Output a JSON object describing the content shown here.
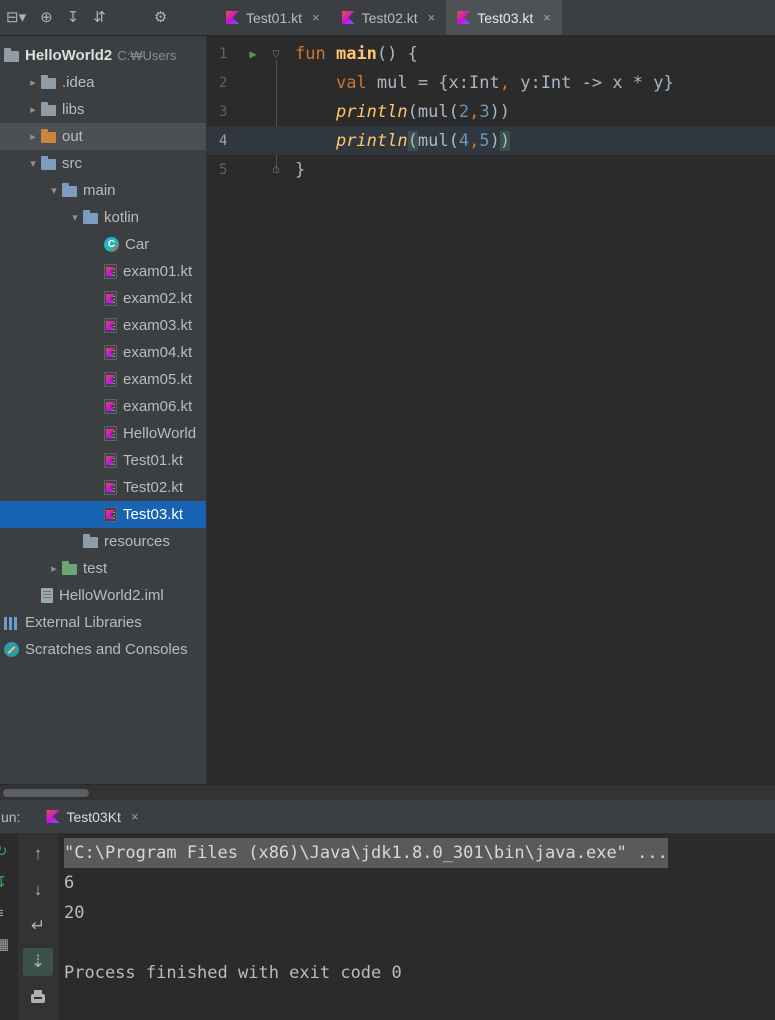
{
  "colors": {
    "selection_blue": "#1963B4",
    "hover_grey": "#4C5052",
    "keyword_orange": "#CC7832",
    "function_yellow": "#FFC66B",
    "number_blue": "#6897BB",
    "run_green": "#499C54",
    "panel_bg": "#3C3F41",
    "editor_bg": "#2B2B2B",
    "console_highlight": "#5A5A5A"
  },
  "ui": {
    "close_glyph": "×",
    "chevron_down": "▾",
    "chevron_right": "▸",
    "run_arrow": "▶",
    "fold_marker": "⌂"
  },
  "toolbar": {
    "icons": [
      {
        "name": "main-menu-icon",
        "glyph": "⊟▾"
      },
      {
        "name": "navigate-icon",
        "glyph": "⊕"
      },
      {
        "name": "update-project-icon",
        "glyph": "↧"
      },
      {
        "name": "sync-icon",
        "glyph": "⇵"
      },
      {
        "name": "settings-icon",
        "glyph": "⚙",
        "gap": true
      }
    ]
  },
  "tabs": [
    {
      "label": "Test01.kt",
      "active": false
    },
    {
      "label": "Test02.kt",
      "active": false
    },
    {
      "label": "Test03.kt",
      "active": true
    }
  ],
  "project": {
    "items": [
      {
        "label": "HelloWorld2",
        "sub": "C:₩Users",
        "level": 0,
        "chev": "none",
        "icon": "folder",
        "bold": true
      },
      {
        "label": ".idea",
        "level": 1,
        "chev": "right",
        "icon": "folder"
      },
      {
        "label": "libs",
        "level": 1,
        "chev": "right",
        "icon": "folder"
      },
      {
        "label": "out",
        "level": 1,
        "chev": "right",
        "icon": "folder-out",
        "hovered": true
      },
      {
        "label": "src",
        "level": 1,
        "chev": "down",
        "icon": "folder-src"
      },
      {
        "label": "main",
        "level": 2,
        "chev": "down",
        "icon": "folder-src"
      },
      {
        "label": "kotlin",
        "level": 3,
        "chev": "down",
        "icon": "folder-src"
      },
      {
        "label": "Car",
        "level": 4,
        "chev": "none",
        "icon": "ktclass"
      },
      {
        "label": "exam01.kt",
        "level": 4,
        "chev": "none",
        "icon": "ktfile"
      },
      {
        "label": "exam02.kt",
        "level": 4,
        "chev": "none",
        "icon": "ktfile"
      },
      {
        "label": "exam03.kt",
        "level": 4,
        "chev": "none",
        "icon": "ktfile"
      },
      {
        "label": "exam04.kt",
        "level": 4,
        "chev": "none",
        "icon": "ktfile"
      },
      {
        "label": "exam05.kt",
        "level": 4,
        "chev": "none",
        "icon": "ktfile"
      },
      {
        "label": "exam06.kt",
        "level": 4,
        "chev": "none",
        "icon": "ktfile"
      },
      {
        "label": "HelloWorld",
        "level": 4,
        "chev": "none",
        "icon": "ktfile"
      },
      {
        "label": "Test01.kt",
        "level": 4,
        "chev": "none",
        "icon": "ktfile"
      },
      {
        "label": "Test02.kt",
        "level": 4,
        "chev": "none",
        "icon": "ktfile"
      },
      {
        "label": "Test03.kt",
        "level": 4,
        "chev": "none",
        "icon": "ktfile",
        "selected": true
      },
      {
        "label": "resources",
        "level": 3,
        "chev": "none",
        "icon": "folder"
      },
      {
        "label": "test",
        "level": 2,
        "chev": "right",
        "icon": "folder-test"
      },
      {
        "label": "HelloWorld2.iml",
        "level": 1,
        "chev": "none",
        "icon": "file"
      },
      {
        "label": "External Libraries",
        "level": 0,
        "chev": "none",
        "icon": "lib"
      },
      {
        "label": "Scratches and Consoles",
        "level": 0,
        "chev": "none",
        "icon": "scratch"
      }
    ]
  },
  "editor": {
    "lines": [
      {
        "num": "1",
        "run": true,
        "fold": "start",
        "current": false,
        "segments": [
          {
            "t": "fun",
            "c": "kw"
          },
          {
            "t": " ",
            "c": "pl"
          },
          {
            "t": "main",
            "c": "fn"
          },
          {
            "t": "() {",
            "c": "pl"
          }
        ]
      },
      {
        "num": "2",
        "run": false,
        "fold": "",
        "current": false,
        "segments": [
          {
            "t": "    ",
            "c": "pl"
          },
          {
            "t": "val",
            "c": "kw"
          },
          {
            "t": " mul = {x:Int",
            "c": "pl"
          },
          {
            "t": ",",
            "c": "cm"
          },
          {
            "t": " y:Int -> x * y}",
            "c": "pl"
          }
        ]
      },
      {
        "num": "3",
        "run": false,
        "fold": "",
        "current": false,
        "segments": [
          {
            "t": "    ",
            "c": "pl"
          },
          {
            "t": "println",
            "c": "call"
          },
          {
            "t": "(",
            "c": "pl"
          },
          {
            "t": "mul(",
            "c": "pl"
          },
          {
            "t": "2",
            "c": "num"
          },
          {
            "t": ",",
            "c": "cm"
          },
          {
            "t": "3",
            "c": "num"
          },
          {
            "t": "))",
            "c": "pl"
          }
        ]
      },
      {
        "num": "4",
        "run": false,
        "fold": "",
        "current": true,
        "segments": [
          {
            "t": "    ",
            "c": "pl"
          },
          {
            "t": "println",
            "c": "call"
          },
          {
            "t": "(",
            "c": "pl hl"
          },
          {
            "t": "mul(",
            "c": "pl"
          },
          {
            "t": "4",
            "c": "num"
          },
          {
            "t": ",",
            "c": "cm"
          },
          {
            "t": "5",
            "c": "num"
          },
          {
            "t": ")",
            "c": "pl"
          },
          {
            "t": ")",
            "c": "pl hl"
          }
        ]
      },
      {
        "num": "5",
        "run": false,
        "fold": "end",
        "current": false,
        "segments": [
          {
            "t": "}",
            "c": "pl"
          }
        ]
      }
    ]
  },
  "run": {
    "label": "un:",
    "tab": {
      "label": "Test03Kt"
    },
    "toolbar_icons": [
      {
        "name": "prev-occurrence-icon",
        "glyph": "↑"
      },
      {
        "name": "next-occurrence-icon",
        "glyph": "↓"
      },
      {
        "name": "soft-wrap-icon",
        "glyph": "↵"
      },
      {
        "name": "scroll-to-end-icon",
        "glyph": "⇣",
        "selected": true
      },
      {
        "name": "print-icon",
        "shape": "printer"
      }
    ],
    "stripe_icons": [
      {
        "name": "rerun-icon",
        "glyph": "↻",
        "green": true
      },
      {
        "name": "run-config-icon",
        "glyph": "↧",
        "green": true
      },
      {
        "name": "options-icon",
        "glyph": "≡"
      },
      {
        "name": "restore-layout-icon",
        "glyph": "▦"
      }
    ],
    "console_lines": [
      {
        "text": "\"C:\\Program Files (x86)\\Java\\jdk1.8.0_301\\bin\\java.exe\" ...",
        "highlight": true
      },
      {
        "text": "6",
        "highlight": false
      },
      {
        "text": "20",
        "highlight": false
      },
      {
        "text": "",
        "highlight": false
      },
      {
        "text": "Process finished with exit code 0",
        "highlight": false
      }
    ]
  }
}
